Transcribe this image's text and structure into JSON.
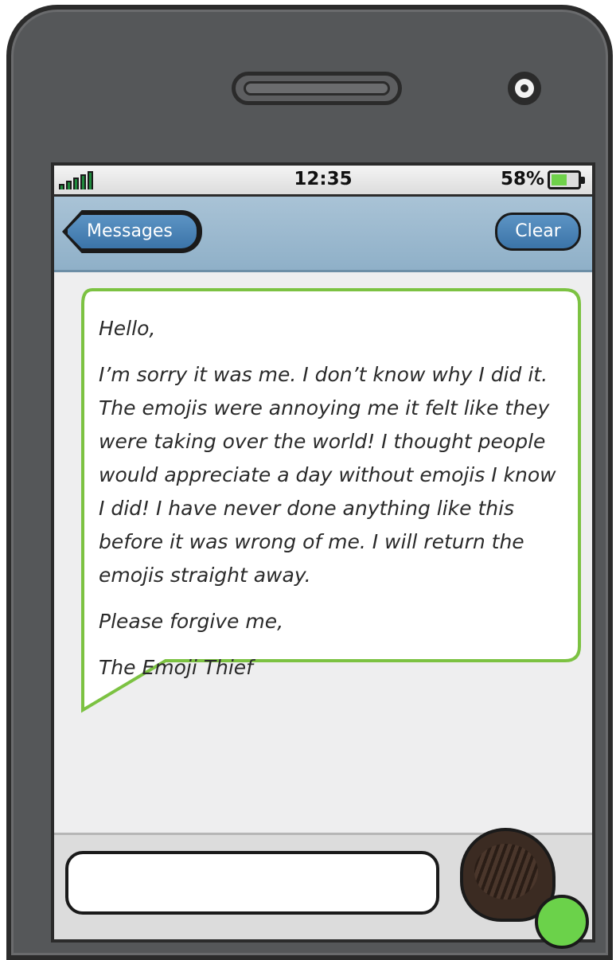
{
  "status_bar": {
    "time": "12:35",
    "battery_percent": "58%",
    "battery_level": 0.58,
    "signal_bars": 5
  },
  "nav": {
    "back_label": "Messages",
    "clear_label": "Clear"
  },
  "message": {
    "greeting": "Hello,",
    "body": "I’m sorry it was me. I don’t know why I did it. The emojis were annoying me it felt like they were taking over the world! I thought people would appreciate a day without emojis I know I did! I have never done anything like this before it was wrong of me. I will return the emojis straight away.",
    "closing": "Please forgive me,",
    "signature": "The Emoji Thief"
  },
  "colors": {
    "bubble_border": "#7cc242",
    "nav_button": "#4a86ba",
    "battery_fill": "#6fd14a",
    "signal": "#1f8a3d"
  },
  "icons": [
    "signal-icon",
    "battery-icon",
    "speaker-grille",
    "front-camera"
  ]
}
